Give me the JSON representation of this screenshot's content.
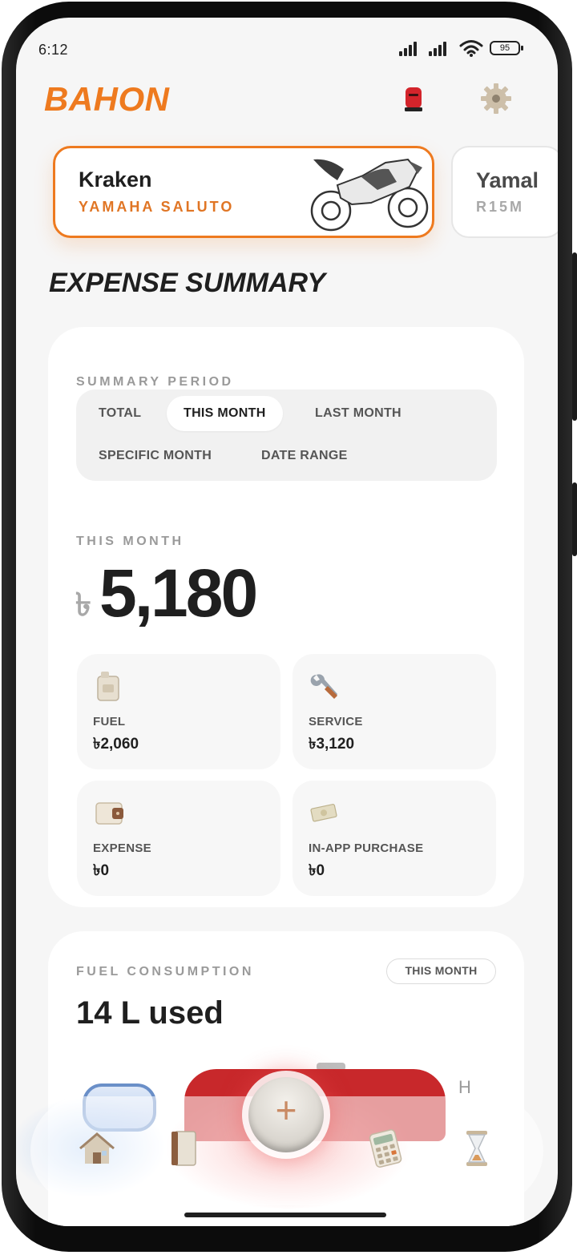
{
  "status_bar": {
    "time": "6:12",
    "battery": "95"
  },
  "header": {
    "app_name": "BAHON",
    "mail_icon": "mailbox-icon",
    "settings_icon": "gear-icon"
  },
  "vehicles": [
    {
      "name": "Kraken",
      "model": "YAMAHA SALUTO",
      "selected": true
    },
    {
      "name": "Yamal",
      "model": "R15M",
      "selected": false
    }
  ],
  "page_title": "EXPENSE SUMMARY",
  "summary": {
    "period_label": "SUMMARY PERIOD",
    "periods": [
      "TOTAL",
      "THIS MONTH",
      "LAST MONTH",
      "SPECIFIC MONTH",
      "DATE RANGE"
    ],
    "selected_period": "THIS MONTH",
    "total_label": "THIS MONTH",
    "currency_symbol": "৳",
    "total_amount": "5,180",
    "categories": [
      {
        "label": "FUEL",
        "value": "৳2,060",
        "icon": "fuel-can-icon"
      },
      {
        "label": "SERVICE",
        "value": "৳3,120",
        "icon": "wrench-icon"
      },
      {
        "label": "EXPENSE",
        "value": "৳0",
        "icon": "wallet-icon"
      },
      {
        "label": "IN-APP PURCHASE",
        "value": "৳0",
        "icon": "cash-icon"
      }
    ]
  },
  "fuel_consumption": {
    "label": "FUEL CONSUMPTION",
    "badge": "THIS MONTH",
    "used_text": "14 L used",
    "gauge_mark": "H"
  },
  "bottom_nav": {
    "items": [
      "home-icon",
      "logbook-icon",
      "add-icon",
      "calculator-icon",
      "hourglass-icon"
    ],
    "fab_symbol": "+"
  },
  "colors": {
    "accent": "#ee7a1f",
    "background": "#f6f6f6",
    "tank_red": "#c8282b"
  }
}
